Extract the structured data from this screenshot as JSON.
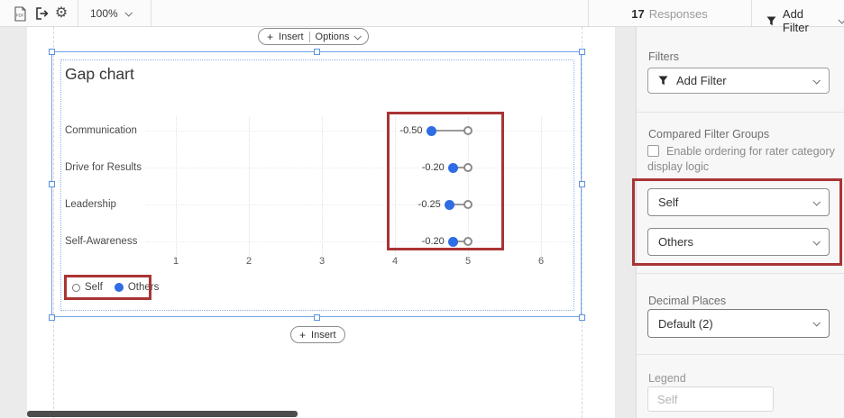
{
  "colors": {
    "selection_blue": "#6FA3E8",
    "dot_blue": "#2E6DE3",
    "annotation_red": "#A93434"
  },
  "toolbar": {
    "pdf_icon": "pdf-document",
    "export_icon": "export-arrow",
    "settings_icon": "gear",
    "zoom_value": "100%",
    "responses_count": "17",
    "responses_label": "Responses",
    "add_filter_label": "Add Filter"
  },
  "page": {
    "insert_label": "Insert",
    "options_label": "Options",
    "bottom_insert_label": "Insert"
  },
  "chart_data": {
    "type": "dumbbell",
    "title": "Gap chart",
    "categories": [
      "Communication",
      "Drive for Results",
      "Leadership",
      "Self-Awareness"
    ],
    "series": [
      {
        "name": "Self",
        "marker": "open-circle",
        "color": "#777777",
        "values": [
          5.0,
          5.0,
          5.0,
          5.0
        ]
      },
      {
        "name": "Others",
        "marker": "filled-circle",
        "color": "#2E6DE3",
        "values": [
          4.5,
          4.8,
          4.75,
          4.8
        ]
      }
    ],
    "gap_labels": [
      "-0.50",
      "-0.20",
      "-0.25",
      "-0.20"
    ],
    "x_ticks": [
      1,
      2,
      3,
      4,
      5,
      6
    ],
    "xlim": [
      0,
      6.5
    ],
    "legend_position": "bottom-left",
    "grid": "dotted"
  },
  "sidebar": {
    "filters_heading": "Filters",
    "add_filter_label": "Add Filter",
    "compared_heading": "Compared Filter Groups",
    "ordering_checkbox_label": "Enable ordering for rater category display logic",
    "ordering_checkbox_checked": false,
    "group_dropdowns": [
      "Self",
      "Others"
    ],
    "decimal_heading": "Decimal Places",
    "decimal_value": "Default (2)",
    "legend_heading": "Legend",
    "legend_placeholder": "Self"
  }
}
